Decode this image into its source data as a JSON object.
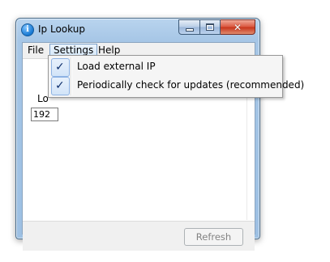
{
  "window": {
    "title": "Ip Lookup",
    "app_icon_glyph": "i",
    "close_glyph": "✕"
  },
  "menubar": {
    "file": "File",
    "settings": "Settings",
    "help": "Help"
  },
  "content": {
    "local_label": "Lo",
    "ip_value": "192"
  },
  "footer": {
    "refresh_label": "Refresh"
  },
  "settings_menu": {
    "items": [
      {
        "label": "Load external IP",
        "checked": true,
        "check_glyph": "✓"
      },
      {
        "label": "Periodically check for updates (recommended)",
        "checked": true,
        "check_glyph": "✓"
      }
    ]
  },
  "colors": {
    "title_bar": "#a6c6e6",
    "close_button": "#c7321a",
    "menu_highlight": "#d6e8f9",
    "checkmark": "#0c2d6b"
  }
}
